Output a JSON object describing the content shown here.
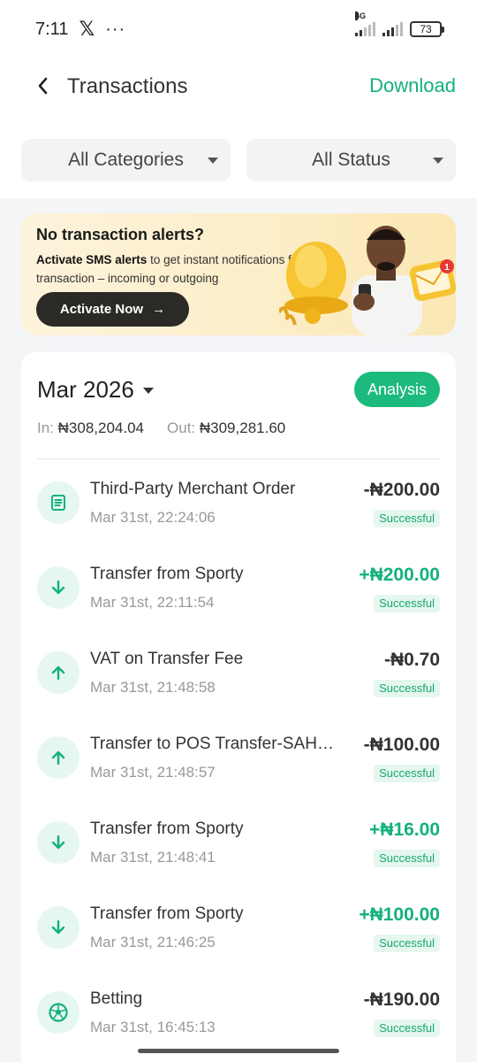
{
  "status_bar": {
    "time": "7:11",
    "x_glyph": "𝕏",
    "dots": "···",
    "network": "4G",
    "battery": "73"
  },
  "header": {
    "back_icon": "chevron-left-icon",
    "title": "Transactions",
    "download_label": "Download"
  },
  "filters": {
    "categories_label": "All Categories",
    "status_label": "All Status"
  },
  "promo": {
    "title": "No transaction alerts?",
    "text_bold": "Activate SMS alerts",
    "text_rest": " to get instant notifications for every transaction – incoming or outgoing",
    "button_label": "Activate Now",
    "button_arrow": "→",
    "badge_count": "1"
  },
  "summary": {
    "month": "Mar 2026",
    "analysis_label": "Analysis",
    "in_label": "In:",
    "in_value": "₦308,204.04",
    "out_label": "Out:",
    "out_value": "₦309,281.60"
  },
  "transactions": [
    {
      "icon": "document-icon",
      "name": "Third-Party Merchant Order",
      "time": "Mar 31st, 22:24:06",
      "amount": "-₦200.00",
      "direction": "out",
      "status": "Successful"
    },
    {
      "icon": "arrow-down-icon",
      "name": "Transfer from Sporty",
      "time": "Mar 31st, 22:11:54",
      "amount": "+₦200.00",
      "direction": "in",
      "status": "Successful"
    },
    {
      "icon": "arrow-up-icon",
      "name": "VAT on Transfer Fee",
      "time": "Mar 31st, 21:48:58",
      "amount": "-₦0.70",
      "direction": "out",
      "status": "Successful"
    },
    {
      "icon": "arrow-up-icon",
      "name": "Transfer to POS Transfer-SAHA...",
      "time": "Mar 31st, 21:48:57",
      "amount": "-₦100.00",
      "direction": "out",
      "status": "Successful"
    },
    {
      "icon": "arrow-down-icon",
      "name": "Transfer from Sporty",
      "time": "Mar 31st, 21:48:41",
      "amount": "+₦16.00",
      "direction": "in",
      "status": "Successful"
    },
    {
      "icon": "arrow-down-icon",
      "name": "Transfer from Sporty",
      "time": "Mar 31st, 21:46:25",
      "amount": "+₦100.00",
      "direction": "in",
      "status": "Successful"
    },
    {
      "icon": "soccer-ball-icon",
      "name": "Betting",
      "time": "Mar 31st, 16:45:13",
      "amount": "-₦190.00",
      "direction": "out",
      "status": "Successful"
    }
  ],
  "colors": {
    "accent": "#13b27a",
    "analysis_bg": "#1cba7d",
    "icon_bg": "#e6f7ef",
    "promo_button": "#2b2a27"
  }
}
